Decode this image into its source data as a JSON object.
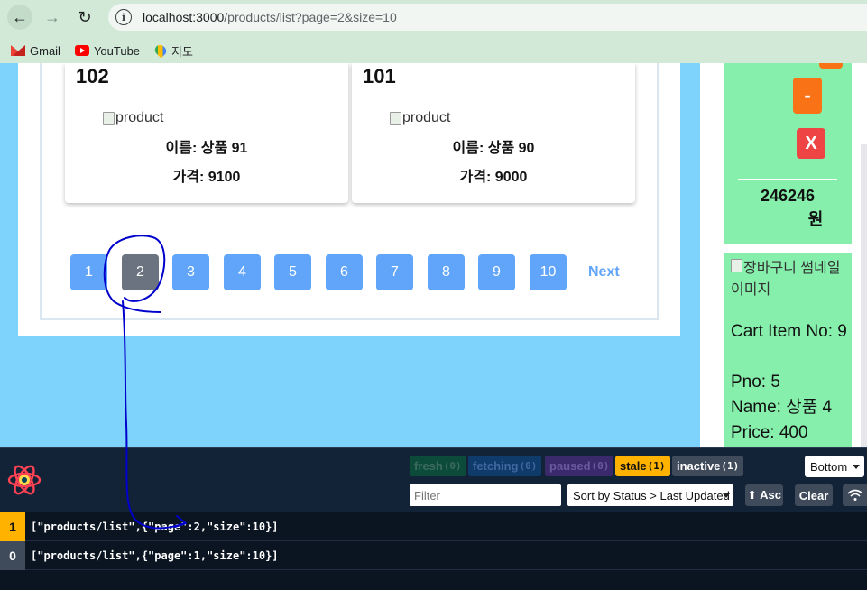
{
  "browser": {
    "url_host": "localhost:3000",
    "url_path": "/products/list?page=2&size=10",
    "bookmarks": [
      {
        "label": "Gmail",
        "icon": "gmail-icon"
      },
      {
        "label": "YouTube",
        "icon": "youtube-icon"
      },
      {
        "label": "지도",
        "icon": "maps-icon"
      }
    ]
  },
  "products": [
    {
      "pno": "102",
      "img_alt": "product",
      "name": "이름: 상품 91",
      "price": "가격: 9100"
    },
    {
      "pno": "101",
      "img_alt": "product",
      "name": "이름: 상품 90",
      "price": "가격: 9000"
    }
  ],
  "pagination": {
    "pages": [
      "1",
      "2",
      "3",
      "4",
      "5",
      "6",
      "7",
      "8",
      "9",
      "10"
    ],
    "current": "2",
    "next_label": "Next"
  },
  "cart": {
    "minus_label": "-",
    "remove_label": "X",
    "total_amount": "246246",
    "total_unit": "원",
    "item": {
      "img_alt": "장바구니 썸네일 이미지",
      "cino": "Cart Item No: 9",
      "pno": "Pno: 5",
      "name": "Name: 상품 4",
      "price": "Price: 400"
    }
  },
  "devtools": {
    "badges": {
      "fresh": "fresh",
      "fresh_count": "(0)",
      "fetching": "fetching",
      "fetching_count": "(0)",
      "paused": "paused",
      "paused_count": "(0)",
      "stale": "stale",
      "stale_count": "(1)",
      "inactive": "inactive",
      "inactive_count": "(1)"
    },
    "position_select": "Bottom",
    "filter_placeholder": "Filter",
    "sort_select": "Sort by Status > Last Updated",
    "asc_label": "⬆ Asc",
    "clear_label": "Clear",
    "queries": [
      {
        "count": "1",
        "status": "stale",
        "key": "[\"products/list\",{\"page\":2,\"size\":10}]"
      },
      {
        "count": "0",
        "status": "inactive",
        "key": "[\"products/list\",{\"page\":1,\"size\":10}]"
      }
    ]
  },
  "colors": {
    "page_bg": "#7dd3fc",
    "page_button": "#60a5fa",
    "active_page": "#6b7280",
    "cart_bg": "#86efac",
    "minus_button": "#f97316",
    "remove_button": "#ef4444",
    "stale": "#ffb200",
    "annotation_ink": "#0000cc"
  }
}
